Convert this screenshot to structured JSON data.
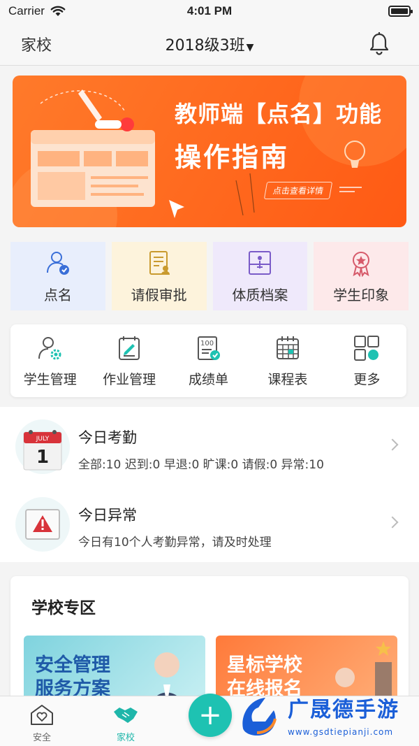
{
  "status_bar": {
    "carrier": "Carrier",
    "time": "4:01 PM"
  },
  "nav": {
    "left_label": "家校",
    "title": "2018级3班"
  },
  "banner": {
    "line1": "教师端【点名】功能",
    "line2": "操作指南",
    "link_label": "点击查看详情"
  },
  "quick_actions": [
    {
      "label": "点名",
      "icon": "user-check-icon",
      "bg": "#e8eefc",
      "color": "#3a6fd8"
    },
    {
      "label": "请假审批",
      "icon": "leave-form-icon",
      "bg": "#fdf3dc",
      "color": "#c99a2e"
    },
    {
      "label": "体质档案",
      "icon": "body-record-icon",
      "bg": "#efe9fb",
      "color": "#7a5bc8"
    },
    {
      "label": "学生印象",
      "icon": "badge-ribbon-icon",
      "bg": "#fde9ea",
      "color": "#d65a6a"
    }
  ],
  "tools": [
    {
      "label": "学生管理",
      "icon": "student-manage-icon"
    },
    {
      "label": "作业管理",
      "icon": "homework-icon"
    },
    {
      "label": "成绩单",
      "icon": "score-report-icon"
    },
    {
      "label": "课程表",
      "icon": "schedule-icon"
    },
    {
      "label": "更多",
      "icon": "grid-more-icon"
    }
  ],
  "attendance": {
    "title": "今日考勤",
    "desc": "全部:10 迟到:0 早退:0 旷课:0 请假:0 异常:10",
    "calendar_month": "JULY",
    "calendar_day": "1"
  },
  "abnormal": {
    "title": "今日异常",
    "desc": "今日有10个人考勤异常，请及时处理"
  },
  "school_zone": {
    "title": "学校专区",
    "promos": [
      {
        "text": "安全管理\n服务方案"
      },
      {
        "text": "星标学校\n在线报名"
      }
    ]
  },
  "tabbar": {
    "tabs": [
      {
        "label": "安全"
      },
      {
        "label": "家校"
      }
    ]
  },
  "watermark": {
    "text": "广晟德手游",
    "url": "www.gsdtiepianji.com"
  },
  "colors": {
    "accent": "#1ec2b2",
    "banner": "#ff6a1f"
  }
}
